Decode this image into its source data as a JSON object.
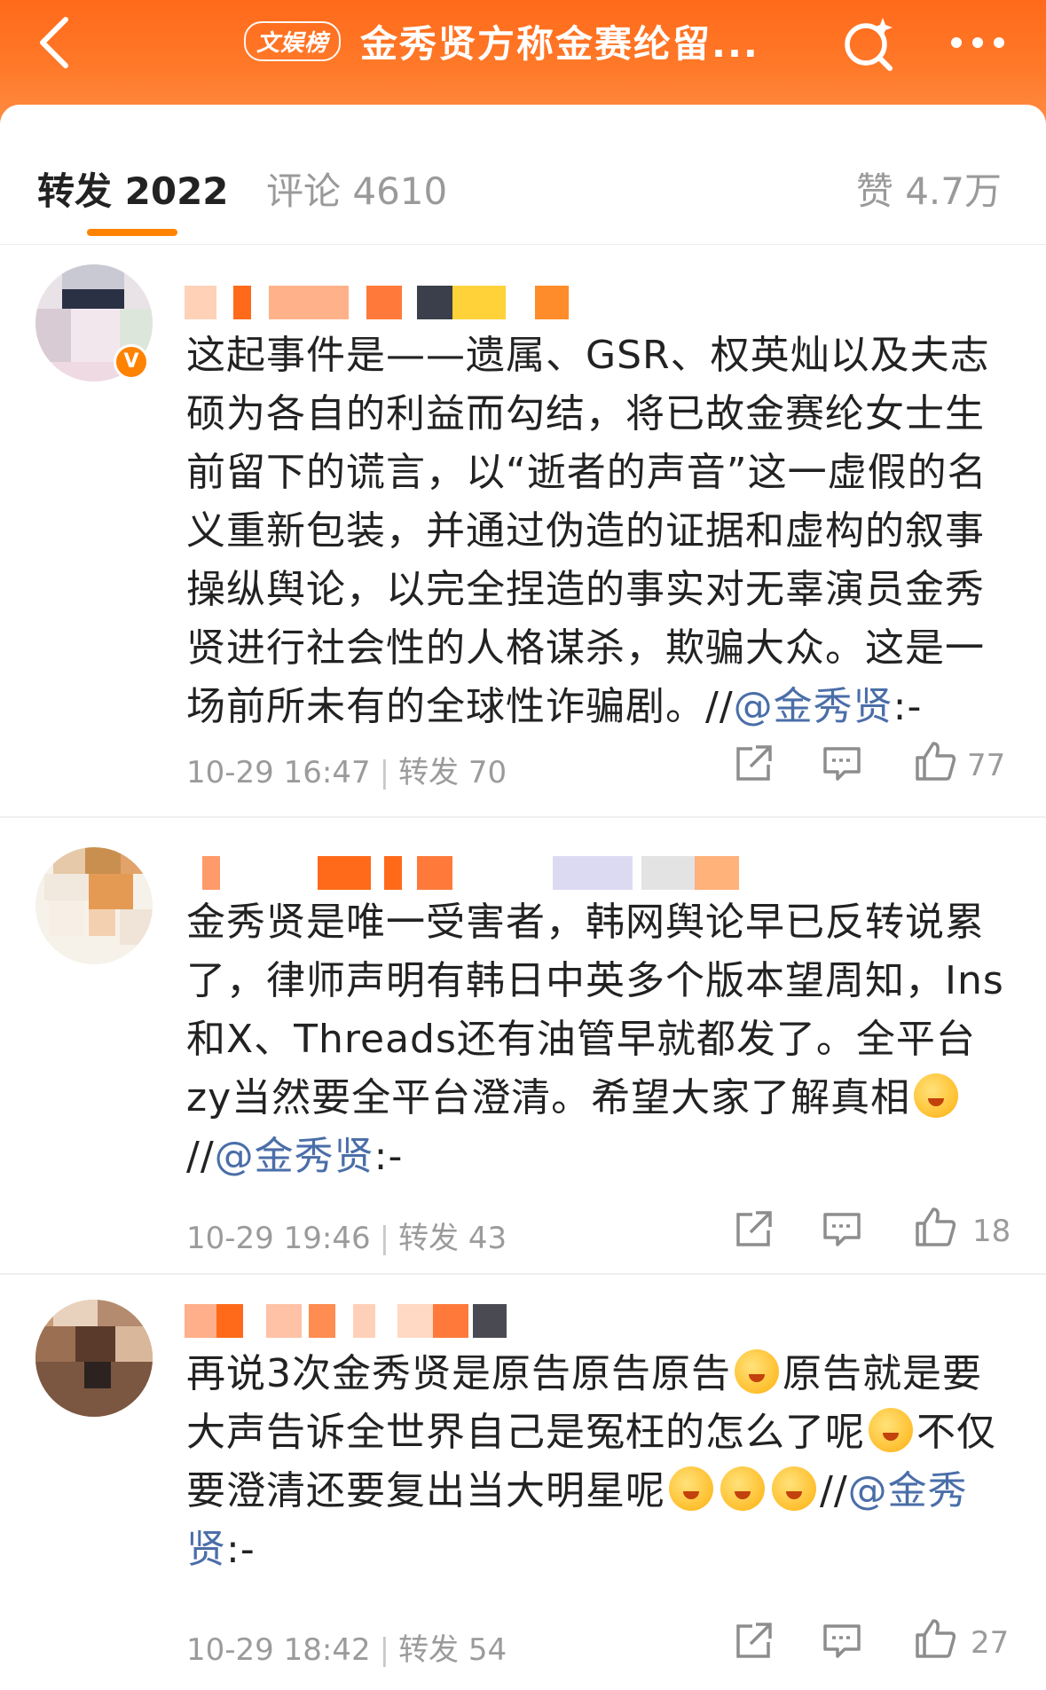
{
  "header": {
    "topic_badge": "文娱榜",
    "title": "金秀贤方称金赛纶留..."
  },
  "tabs": {
    "repost": "转发 2022",
    "comment": "评论 4610",
    "like": "赞 4.7万"
  },
  "items": [
    {
      "verified_badge": "V",
      "text": "这起事件是——遗属、GSR、权英灿以及夫志硕为各自的利益而勾结，将已故金赛纶女士生前留下的谎言，以“逝者的声音”这一虚假的名义重新包装，并通过伪造的证据和虚构的叙事操纵舆论，以完全捏造的事实对无辜演员金秀贤进行社会性的人格谋杀，欺骗大众。这是一场前所未有的全球性诈骗剧。//",
      "mention": "@金秀贤",
      "suffix": ":-",
      "time": "10-29 16:47",
      "repost": "转发 70",
      "likes": "77"
    },
    {
      "text_a": "金秀贤是唯一受害者，韩网舆论早已反转说累了，律师声明有韩日中英多个版本望周知，Ins和X、Threads还有油管早就都发了。全平台zy当然要全平台澄清。希望大家了解真相",
      "text_b": "//",
      "mention": "@金秀贤",
      "suffix": ":-",
      "time": "10-29 19:46",
      "repost": "转发 43",
      "likes": "18"
    },
    {
      "text_a": "再说3次金秀贤是原告原告原告",
      "text_b": "原告就是要大声告诉全世界自己是冤枉的怎么了呢",
      "text_c": "不仅要澄清还要复出当大明星呢",
      "text_d": "//",
      "mention": "@金秀贤",
      "suffix": ":-",
      "time": "10-29 18:42",
      "repost": "转发 54",
      "likes": "27"
    }
  ],
  "colors": {
    "brand_orange": "#ff8200",
    "header_orange": "#ff7a2a",
    "mention_blue": "#4a6ea8",
    "muted_gray": "#9b9b9b"
  },
  "icons": [
    "back-arrow-icon",
    "search-sparkle-icon",
    "more-dots-icon",
    "share-icon",
    "comment-icon",
    "like-icon"
  ]
}
